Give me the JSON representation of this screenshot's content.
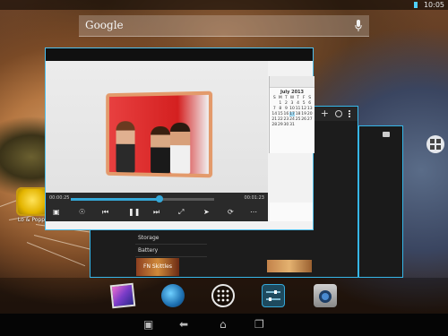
{
  "status_bar": {
    "time": "10:05",
    "battery_color": "#4fd0ff"
  },
  "search": {
    "brand": "Google",
    "mic_icon": "microphone-icon"
  },
  "desktop": {
    "shortcut_label": "Lo & Poppet",
    "grid_button_icon": "widget-grid-icon"
  },
  "recents": {
    "video_player": {
      "time_elapsed": "00:00:25",
      "time_total": "00:01:23",
      "progress": 0.62,
      "controls": [
        "screen-icon",
        "brightness-icon",
        "previous-icon",
        "pause-icon",
        "next-icon",
        "shrink-icon",
        "cursor-icon",
        "repeat-icon",
        "more-icon"
      ]
    },
    "calendar": {
      "month": "July 2013",
      "weekdays": [
        "S",
        "M",
        "T",
        "W",
        "T",
        "F",
        "S"
      ],
      "days": [
        "",
        "1",
        "2",
        "3",
        "4",
        "5",
        "6",
        "7",
        "8",
        "9",
        "10",
        "11",
        "12",
        "13",
        "14",
        "15",
        "16",
        "17",
        "18",
        "19",
        "20",
        "21",
        "22",
        "23",
        "24",
        "25",
        "26",
        "27",
        "28",
        "29",
        "30",
        "31"
      ],
      "today": "17"
    },
    "settings_card": {
      "items": [
        "Storage",
        "Battery"
      ],
      "thumbnail_label": "FN Skittles"
    }
  },
  "dock": {
    "items": [
      "gallery-icon",
      "browser-globe-icon",
      "app-drawer-icon",
      "settings-sliders-icon",
      "camera-icon"
    ],
    "accent": "#35a8d8"
  },
  "nav": {
    "items": [
      "screenshot-icon",
      "back-icon",
      "home-icon",
      "recent-apps-icon"
    ]
  }
}
